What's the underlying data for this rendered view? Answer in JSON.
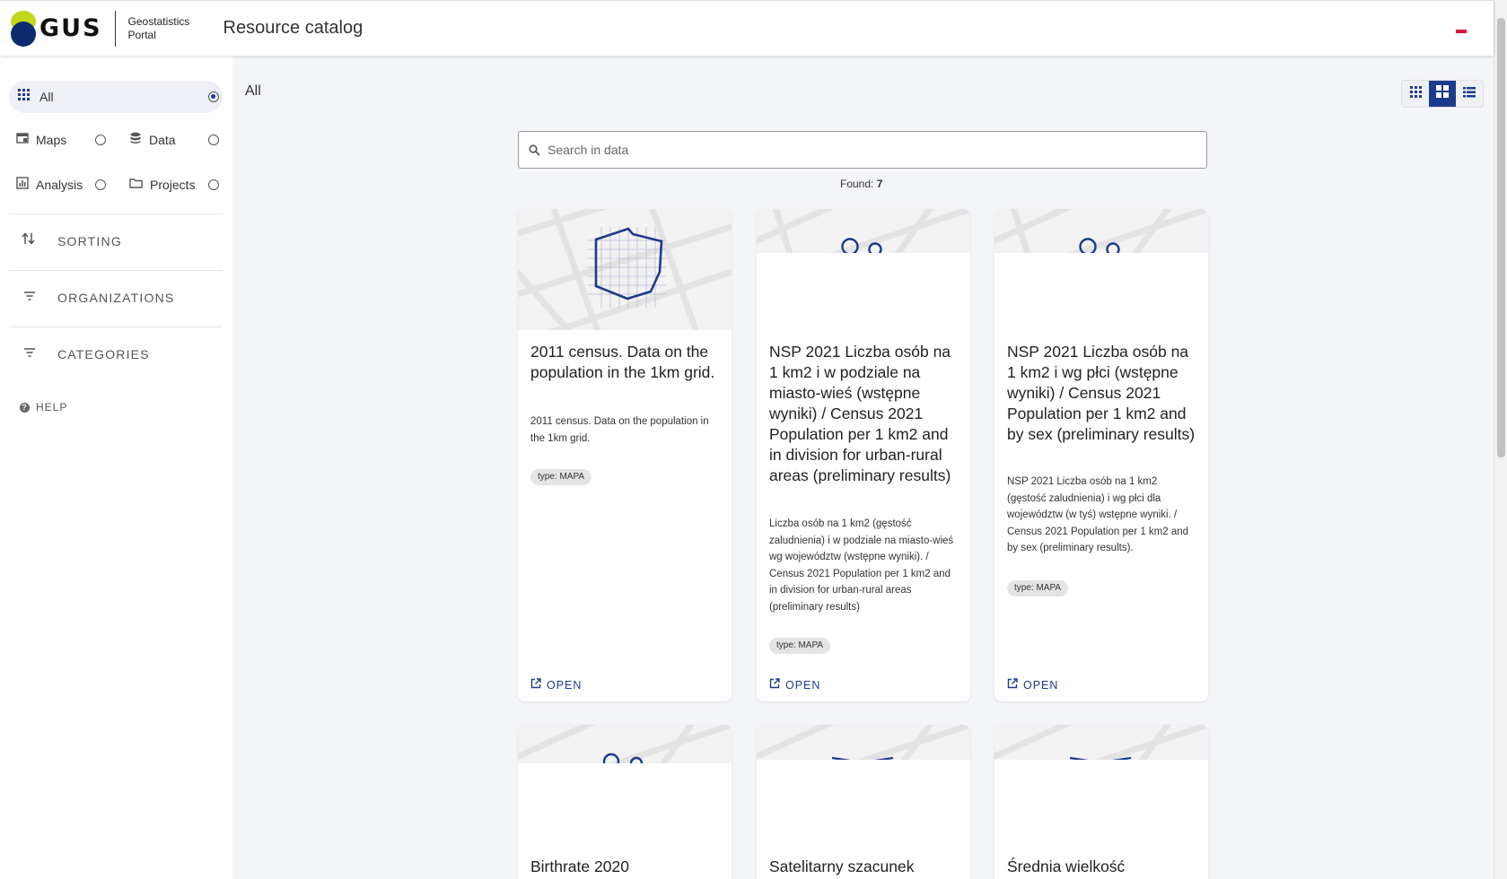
{
  "header": {
    "logo_text": "GUS",
    "portal_name": "Geostatistics Portal",
    "title": "Resource catalog",
    "language_flag": "flag-pl"
  },
  "sidebar": {
    "all_label": "All",
    "filters": [
      {
        "label": "Maps",
        "icon": "map-icon"
      },
      {
        "label": "Data",
        "icon": "database-icon"
      },
      {
        "label": "Analysis",
        "icon": "chart-icon"
      },
      {
        "label": "Projects",
        "icon": "folder-icon"
      }
    ],
    "sections": [
      {
        "label": "SORTING",
        "icon": "sort-icon"
      },
      {
        "label": "ORGANIZATIONS",
        "icon": "filter-icon"
      },
      {
        "label": "CATEGORIES",
        "icon": "filter-icon"
      }
    ],
    "help_label": "HELP"
  },
  "main": {
    "heading": "All",
    "search_placeholder": "Search in data",
    "found_label": "Found:",
    "found_count": "7",
    "view_modes": [
      "small-grid",
      "large-grid",
      "list"
    ],
    "active_view": "large-grid"
  },
  "cards": [
    {
      "title": "2011 census. Data on the population in the 1km grid.",
      "description": "2011 census. Data on the population in the 1km grid.",
      "tag": "type: MAPA",
      "open_label": "OPEN"
    },
    {
      "title": "NSP 2021 Liczba osób na 1 km2 i w podziale na miasto-wieś (wstępne wyniki) / Census 2021 Population per 1 km2 and in division for urban-rural areas (preliminary results)",
      "description": "Liczba osób na 1 km2 (gęstość zaludnienia) i w podziale na miasto-wieś wg województw (wstępne wyniki). / Census 2021 Population per 1 km2 and in division for urban-rural areas (preliminary results)",
      "tag": "type: MAPA",
      "open_label": "OPEN"
    },
    {
      "title": "NSP 2021 Liczba osób na 1 km2 i wg płci (wstępne wyniki) / Census 2021 Population per 1 km2 and by sex (preliminary results)",
      "description": "NSP 2021 Liczba osób na 1 km2 (gęstość zaludnienia) i wg płci dla województw (w tyś) wstępne wyniki. / Census 2021 Population per 1 km2 and by sex (preliminary results).",
      "tag": "type: MAPA",
      "open_label": "OPEN"
    },
    {
      "title": "Birthrate 2020"
    },
    {
      "title": "Satelitarny szacunek"
    },
    {
      "title": "Średnia wielkość"
    }
  ],
  "colors": {
    "brand_navy": "#1d3b8c",
    "logo_lime": "#c3d81c",
    "logo_dark": "#0b2a6f"
  }
}
